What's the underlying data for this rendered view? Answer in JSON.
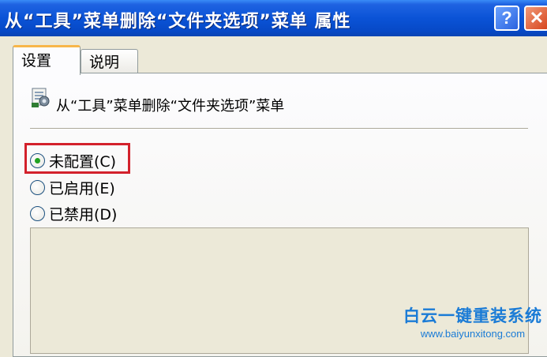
{
  "window": {
    "title": "从“工具”菜单删除“文件夹选项”菜单 属性",
    "help_glyph": "?",
    "close_glyph": "✕"
  },
  "tabs": [
    {
      "label": "设置",
      "active": true
    },
    {
      "label": "说明",
      "active": false
    }
  ],
  "policy": {
    "icon": "policy-setting-icon",
    "title": "从“工具”菜单删除“文件夹选项”菜单"
  },
  "options": [
    {
      "label": "未配置(C)",
      "selected": true
    },
    {
      "label": "已启用(E)",
      "selected": false
    },
    {
      "label": "已禁用(D)",
      "selected": false
    }
  ],
  "highlight_color": "#d3212b",
  "watermark": {
    "line1": "白云一键重装系统",
    "line2": "www.baiyunxitong.com",
    "color": "#1a7bd6"
  }
}
